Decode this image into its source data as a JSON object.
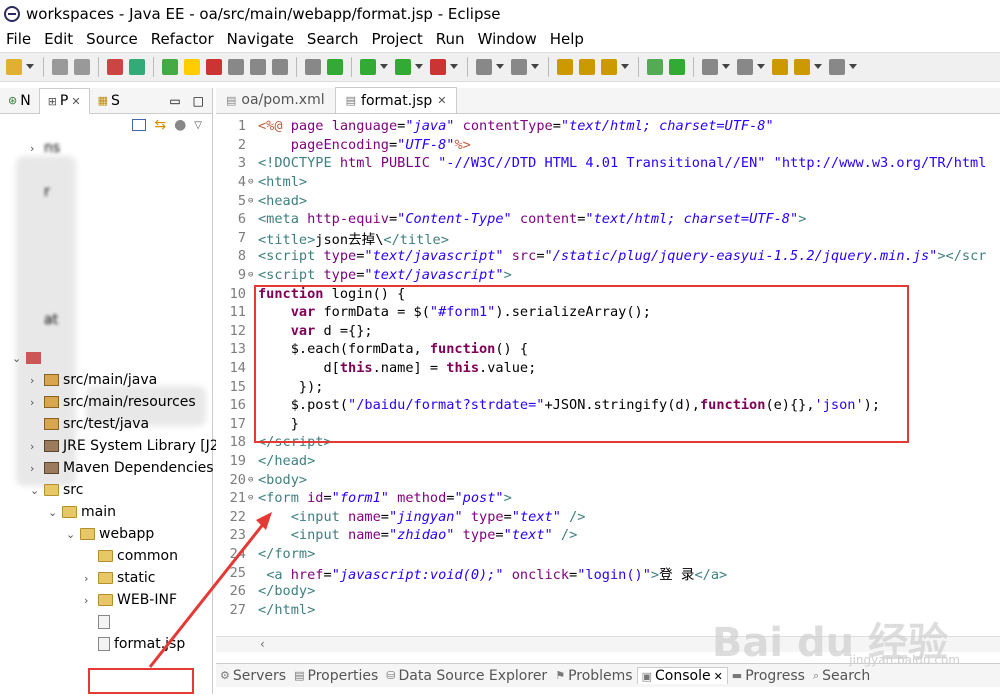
{
  "window": {
    "title": "workspaces - Java EE - oa/src/main/webapp/format.jsp - Eclipse"
  },
  "menu": [
    "File",
    "Edit",
    "Source",
    "Refactor",
    "Navigate",
    "Search",
    "Project",
    "Run",
    "Window",
    "Help"
  ],
  "left_panel": {
    "tabs": [
      "N",
      "P",
      "S"
    ],
    "tree": [
      {
        "label": "ns",
        "indent": 1,
        "arrow": "›",
        "icon": "none",
        "blurred": true
      },
      {
        "label": "r",
        "indent": 1,
        "arrow": "",
        "icon": "none",
        "blurred": true
      },
      {
        "label": "at",
        "indent": 1,
        "arrow": "",
        "icon": "none",
        "blurred": true
      },
      {
        "label": "",
        "indent": 0,
        "arrow": "⌄",
        "icon": "project",
        "blurred": true
      },
      {
        "label": "src/main/java",
        "indent": 1,
        "arrow": "›",
        "icon": "pkg"
      },
      {
        "label": "src/main/resources",
        "indent": 1,
        "arrow": "›",
        "icon": "pkg"
      },
      {
        "label": "src/test/java",
        "indent": 1,
        "arrow": "",
        "icon": "pkg"
      },
      {
        "label": "JRE System Library [J2",
        "indent": 1,
        "arrow": "›",
        "icon": "lib"
      },
      {
        "label": "Maven Dependencies",
        "indent": 1,
        "arrow": "›",
        "icon": "lib"
      },
      {
        "label": "src",
        "indent": 1,
        "arrow": "⌄",
        "icon": "folder"
      },
      {
        "label": "main",
        "indent": 2,
        "arrow": "⌄",
        "icon": "folder"
      },
      {
        "label": "webapp",
        "indent": 3,
        "arrow": "⌄",
        "icon": "folder"
      },
      {
        "label": "common",
        "indent": 4,
        "arrow": "",
        "icon": "folder"
      },
      {
        "label": "static",
        "indent": 4,
        "arrow": "›",
        "icon": "folder"
      },
      {
        "label": "WEB-INF",
        "indent": 4,
        "arrow": "›",
        "icon": "folder"
      },
      {
        "label": "",
        "indent": 4,
        "arrow": "",
        "icon": "file",
        "blurred": true
      },
      {
        "label": "format.jsp",
        "indent": 4,
        "arrow": "",
        "icon": "file",
        "selected": true
      }
    ]
  },
  "editor": {
    "tabs": [
      {
        "label": "oa/pom.xml",
        "active": false
      },
      {
        "label": "format.jsp",
        "active": true
      }
    ],
    "lines": [
      {
        "n": "1",
        "fold": "",
        "html": "<span class='jsp'>&lt;%@</span> <span class='a'>page</span> <span class='a'>language</span>=<span class='s'>\"java\"</span> <span class='a'>contentType</span>=<span class='s'>\"text/html; charset=UTF-8\"</span>"
      },
      {
        "n": "2",
        "fold": "",
        "html": "    <span class='a'>pageEncoding</span>=<span class='s'>\"UTF-8\"</span><span class='jsp'>%&gt;</span>"
      },
      {
        "n": "3",
        "fold": "",
        "html": "<span class='t'>&lt;!DOCTYPE</span> <span class='a'>html PUBLIC</span> <span class='s2'>\"-//W3C//DTD HTML 4.01 Transitional//EN\"</span> <span class='s2'>\"http://www.w3.org/TR/html</span>"
      },
      {
        "n": "4",
        "fold": "⊖",
        "html": "<span class='t'>&lt;html&gt;</span>"
      },
      {
        "n": "5",
        "fold": "⊖",
        "html": "<span class='t'>&lt;head&gt;</span>"
      },
      {
        "n": "6",
        "fold": "",
        "html": "<span class='t'>&lt;meta</span> <span class='a'>http-equiv</span>=<span class='s'>\"Content-Type\"</span> <span class='a'>content</span>=<span class='s'>\"text/html; charset=UTF-8\"</span><span class='t'>&gt;</span>"
      },
      {
        "n": "7",
        "fold": "",
        "html": "<span class='t'>&lt;title&gt;</span>json去掉\\<span class='t'>&lt;/title&gt;</span>"
      },
      {
        "n": "8",
        "fold": "",
        "html": "<span class='t'>&lt;script</span> <span class='a'>type</span>=<span class='s'>\"text/javascript\"</span> <span class='a'>src</span>=<span class='s'>\"/static/plug/jquery-easyui-1.5.2/jquery.min.js\"</span><span class='t'>&gt;&lt;/scr</span>"
      },
      {
        "n": "9",
        "fold": "⊖",
        "html": "<span class='t'>&lt;script</span> <span class='a'>type</span>=<span class='s'>\"text/javascript\"</span><span class='t'>&gt;</span>"
      },
      {
        "n": "10",
        "fold": "",
        "html": "<span class='k'>function</span> login() {"
      },
      {
        "n": "11",
        "fold": "",
        "html": "    <span class='k'>var</span> formData = $(<span class='s2'>\"#form1\"</span>).serializeArray();"
      },
      {
        "n": "12",
        "fold": "",
        "html": "    <span class='k'>var</span> d ={};"
      },
      {
        "n": "13",
        "fold": "",
        "html": "    $.each(formData, <span class='k'>function</span>() {"
      },
      {
        "n": "14",
        "fold": "",
        "html": "        d[<span class='k'>this</span>.name] = <span class='k'>this</span>.value;"
      },
      {
        "n": "15",
        "fold": "",
        "html": "     });"
      },
      {
        "n": "16",
        "fold": "",
        "html": "    $.post(<span class='s2'>\"/baidu/format?strdate=\"</span>+JSON.stringify(d),<span class='k'>function</span>(e){},<span class='s2'>'json'</span>);"
      },
      {
        "n": "17",
        "fold": "",
        "html": "    }"
      },
      {
        "n": "18",
        "fold": "",
        "html": "<span class='t'>&lt;/script&gt;</span>"
      },
      {
        "n": "19",
        "fold": "",
        "html": "<span class='t'>&lt;/head&gt;</span>"
      },
      {
        "n": "20",
        "fold": "⊖",
        "html": "<span class='t'>&lt;body&gt;</span>"
      },
      {
        "n": "21",
        "fold": "⊖",
        "html": "<span class='t'>&lt;form</span> <span class='a'>id</span>=<span class='s'>\"form1\"</span> <span class='a'>method</span>=<span class='s'>\"post\"</span><span class='t'>&gt;</span>"
      },
      {
        "n": "22",
        "fold": "",
        "html": "    <span class='t'>&lt;input</span> <span class='a'>name</span>=<span class='s'>\"jingyan\"</span> <span class='a'>type</span>=<span class='s'>\"text\"</span> <span class='t'>/&gt;</span>"
      },
      {
        "n": "23",
        "fold": "",
        "html": "    <span class='t'>&lt;input</span> <span class='a'>name</span>=<span class='s'>\"zhidao\"</span> <span class='a'>type</span>=<span class='s'>\"text\"</span> <span class='t'>/&gt;</span>"
      },
      {
        "n": "24",
        "fold": "",
        "html": "<span class='t'>&lt;/form&gt;</span>"
      },
      {
        "n": "25",
        "fold": "",
        "html": " <span class='t'>&lt;a</span> <span class='a'>href</span>=<span class='s'>\"javascript:void(0);\"</span> <span class='a'>onclick</span>=<span class='s2'>\"login()\"</span><span class='t'>&gt;</span>登 录<span class='t'>&lt;/a&gt;</span>"
      },
      {
        "n": "26",
        "fold": "",
        "html": "<span class='t'>&lt;/body&gt;</span>"
      },
      {
        "n": "27",
        "fold": "",
        "html": "<span class='t'>&lt;/html&gt;</span>"
      }
    ]
  },
  "bottom_tabs": [
    {
      "label": "Servers",
      "active": false
    },
    {
      "label": "Properties",
      "active": false
    },
    {
      "label": "Data Source Explorer",
      "active": false
    },
    {
      "label": "Problems",
      "active": false
    },
    {
      "label": "Console",
      "active": true
    },
    {
      "label": "Progress",
      "active": false
    },
    {
      "label": "Search",
      "active": false
    }
  ],
  "watermark": {
    "main": "Bai du 经验",
    "sub": "jingyan.baidu.com"
  }
}
